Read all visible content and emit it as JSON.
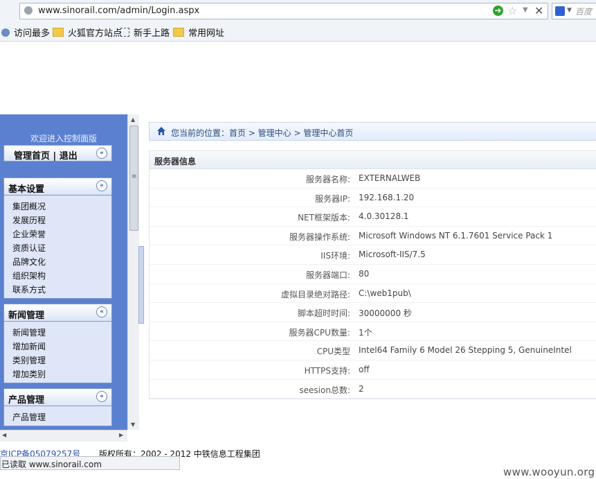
{
  "browser": {
    "url": "www.sinorail.com/admin/Login.aspx",
    "search_placeholder": "百度"
  },
  "bookmarks": [
    {
      "label": "访问最多"
    },
    {
      "label": "火狐官方站点"
    },
    {
      "label": "新手上路"
    },
    {
      "label": "常用网址"
    }
  ],
  "sidebar": {
    "welcome": "欢迎进入控制面版",
    "top_links": "管理首页 | 退出",
    "groups": [
      {
        "title": "基本设置",
        "items": [
          "集团概况",
          "发展历程",
          "企业荣誉",
          "资质认证",
          "品牌文化",
          "组织架构",
          "联系方式"
        ]
      },
      {
        "title": "新闻管理",
        "items": [
          "新闻管理",
          "增加新闻",
          "类别管理",
          "增加类别"
        ]
      },
      {
        "title": "产品管理",
        "items": [
          "产品管理"
        ]
      }
    ]
  },
  "breadcrumb": "您当前的位置：首页 > 管理中心 > 管理中心首页",
  "server_info": {
    "title": "服务器信息",
    "rows": [
      {
        "label": "服务器名称:",
        "value": "EXTERNALWEB"
      },
      {
        "label": "服务器IP:",
        "value": "192.168.1.20"
      },
      {
        "label": "NET框架版本:",
        "value": "4.0.30128.1"
      },
      {
        "label": "服务器操作系统:",
        "value": "Microsoft Windows NT 6.1.7601 Service Pack 1"
      },
      {
        "label": "IIS环境:",
        "value": "Microsoft-IIS/7.5"
      },
      {
        "label": "服务器端口:",
        "value": "80"
      },
      {
        "label": "虚拟目录绝对路径:",
        "value": "C:\\web1pub\\"
      },
      {
        "label": "脚本超时时间:",
        "value": "30000000 秒"
      },
      {
        "label": "服务器CPU数量:",
        "value": "1个"
      },
      {
        "label": "CPU类型",
        "value": "Intel64 Family 6 Model 26 Stepping 5, GenuineIntel"
      },
      {
        "label": "HTTPS支持:",
        "value": "off"
      },
      {
        "label": "seesion总数:",
        "value": "2"
      }
    ]
  },
  "footer": {
    "icp": "京ICP备05079257号",
    "copyright": "版权所有：2002 - 2012 中铁信息工程集团"
  },
  "status": "已读取 www.sinorail.com",
  "watermark": "www.wooyun.org"
}
